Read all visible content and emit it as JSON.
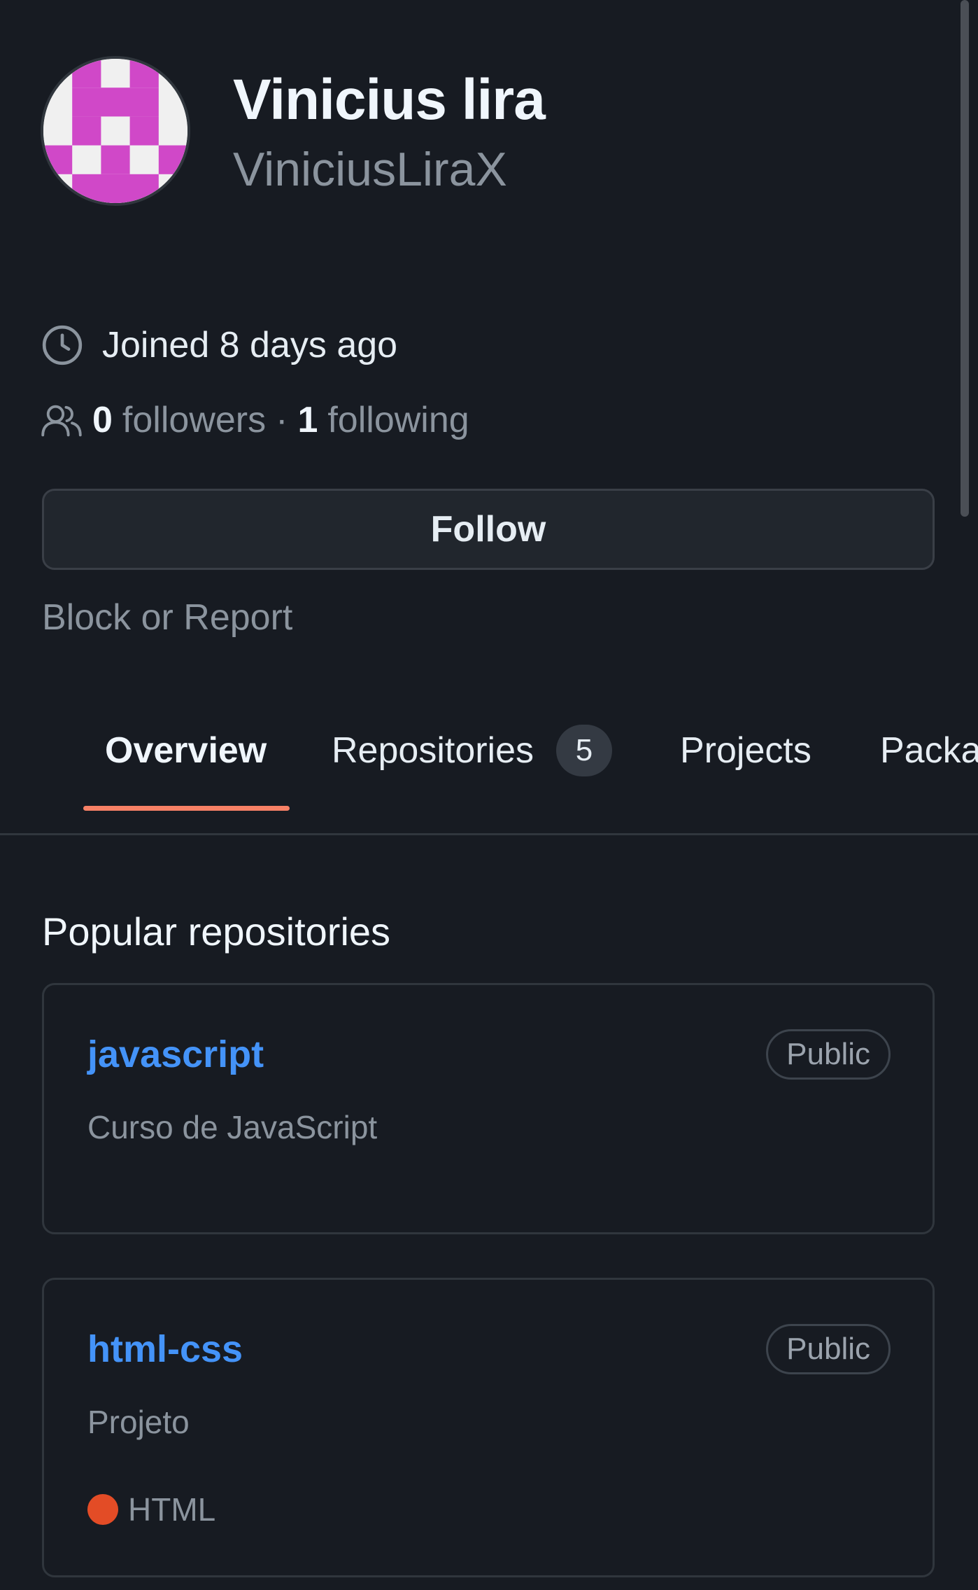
{
  "profile": {
    "display_name": "Vinicius lira",
    "username": "ViniciusLiraX",
    "avatar_colors": {
      "primary": "#d048c8",
      "background": "#f0f0f0"
    }
  },
  "meta": {
    "joined": "Joined 8 days ago",
    "followers_count": "0",
    "followers_label": "followers",
    "separator": "·",
    "following_count": "1",
    "following_label": "following"
  },
  "actions": {
    "follow_label": "Follow",
    "block_report_label": "Block or Report"
  },
  "tabs": [
    {
      "label": "Overview",
      "selected": true
    },
    {
      "label": "Repositories",
      "counter": "5"
    },
    {
      "label": "Projects"
    },
    {
      "label": "Packa"
    }
  ],
  "popular": {
    "title": "Popular repositories",
    "repos": [
      {
        "name": "javascript",
        "visibility": "Public",
        "description": "Curso de JavaScript"
      },
      {
        "name": "html-css",
        "visibility": "Public",
        "description": "Projeto",
        "language": "HTML",
        "language_color": "#e34c26"
      }
    ]
  },
  "colors": {
    "background": "#171b22",
    "accent_underline": "#f78166",
    "link": "#4493f8"
  },
  "icons": {
    "joined": "clock-icon",
    "followers": "people-icon"
  }
}
